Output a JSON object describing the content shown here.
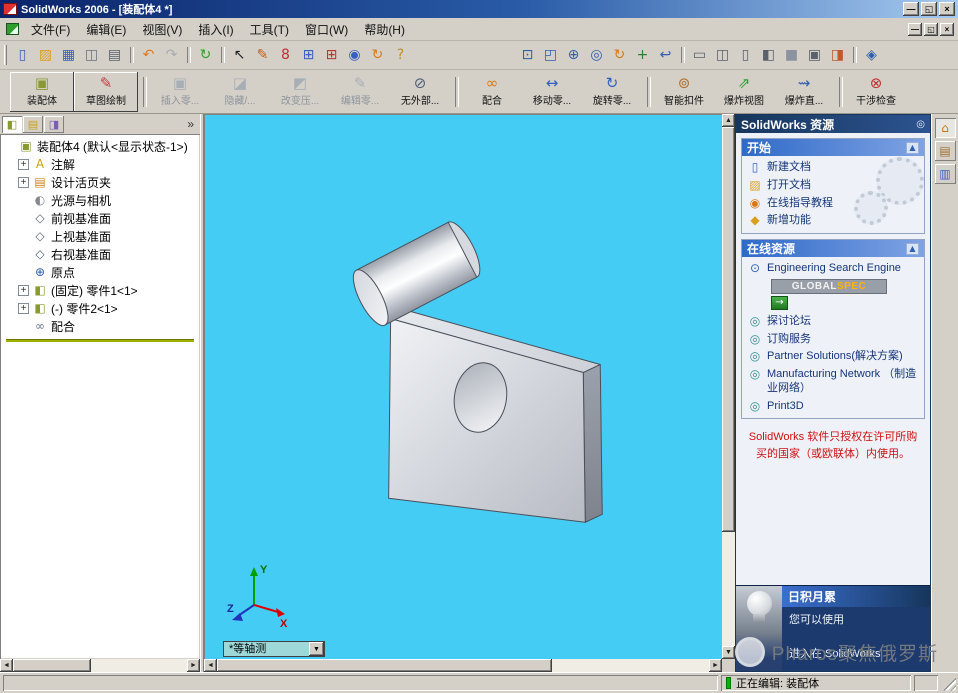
{
  "titlebar": {
    "title": "SolidWorks 2006 - [装配体4 *]"
  },
  "glyphs": {
    "minimize": "—",
    "restore": "◱",
    "close": "×",
    "up": "▲",
    "down": "▼",
    "left": "◄",
    "right": "►",
    "chevron": "»",
    "dropdown": "▼",
    "pin": "◎",
    "go": "→",
    "section_up": "▲",
    "search": "⊙"
  },
  "menubar": {
    "items": [
      "文件(F)",
      "编辑(E)",
      "视图(V)",
      "插入(I)",
      "工具(T)",
      "窗口(W)",
      "帮助(H)"
    ]
  },
  "toolbar_standard": {
    "icons": [
      {
        "name": "new-document-icon",
        "glyph": "▯",
        "color": "#3a5fc0"
      },
      {
        "name": "open-icon",
        "glyph": "▨",
        "color": "#d8a020"
      },
      {
        "name": "save-icon",
        "glyph": "▦",
        "color": "#3a5fc0"
      },
      {
        "name": "make-drawing-icon",
        "glyph": "◫",
        "color": "#6a7282"
      },
      {
        "name": "print-icon",
        "glyph": "▤",
        "color": "#5a616b"
      },
      {
        "name": "undo-icon",
        "glyph": "↶",
        "color": "#e07818",
        "cls": "sep"
      },
      {
        "name": "redo-icon",
        "glyph": "↷",
        "color": "#a6aab2"
      },
      {
        "name": "rebuild-icon",
        "glyph": "↻",
        "color": "#2f9e2f",
        "cls": "sep"
      },
      {
        "name": "select-icon",
        "glyph": "↖",
        "color": "#222222",
        "cls": "sep"
      },
      {
        "name": "sketch-icon",
        "glyph": "✎",
        "color": "#c06020"
      },
      {
        "name": "dimension-icon",
        "glyph": "8",
        "color": "#c03030"
      },
      {
        "name": "grid-icon",
        "glyph": "⊞",
        "color": "#3a5fc0"
      },
      {
        "name": "snap-icon",
        "glyph": "⊞",
        "color": "#c03030"
      },
      {
        "name": "zoom-list-icon",
        "glyph": "◉",
        "color": "#3a5fc0"
      },
      {
        "name": "rotate-icon",
        "glyph": "↻",
        "color": "#e07818"
      },
      {
        "name": "help-icon",
        "glyph": "?",
        "color": "#c09020"
      },
      {
        "name": "zoom-to-fit-icon",
        "glyph": "⊡",
        "color": "#2f5fae",
        "cls": "gap"
      },
      {
        "name": "zoom-area-icon",
        "glyph": "◰",
        "color": "#2f5fae"
      },
      {
        "name": "zoom-in-out-icon",
        "glyph": "⊕",
        "color": "#2f5fae"
      },
      {
        "name": "zoom-selection-icon",
        "glyph": "◎",
        "color": "#2f5fae"
      },
      {
        "name": "rotate-view-icon",
        "glyph": "↻",
        "color": "#d87818"
      },
      {
        "name": "pan-icon",
        "glyph": "+",
        "color": "#2f7f2f"
      },
      {
        "name": "previous-view-icon",
        "glyph": "↩",
        "color": "#2f5fae"
      },
      {
        "name": "wireframe-icon",
        "glyph": "▭",
        "color": "#5a616b",
        "cls": "sep"
      },
      {
        "name": "hidden-lines-visible-icon",
        "glyph": "◫",
        "color": "#5a616b"
      },
      {
        "name": "hidden-lines-removed-icon",
        "glyph": "▯",
        "color": "#5a616b"
      },
      {
        "name": "shaded-edges-icon",
        "glyph": "◧",
        "color": "#5a616b"
      },
      {
        "name": "shaded-icon",
        "glyph": "■",
        "color": "#8b93a0"
      },
      {
        "name": "shadows-icon",
        "glyph": "▣",
        "color": "#5a616b"
      },
      {
        "name": "section-icon",
        "glyph": "◨",
        "color": "#c05a2a"
      },
      {
        "name": "standard-views-icon",
        "glyph": "◈",
        "color": "#2f5fae",
        "cls": "sep"
      }
    ]
  },
  "toolbar_assembly": {
    "buttons": [
      {
        "name": "assembly-toolbar-button",
        "label": "装配体",
        "glyph": "▣",
        "color": "#8a9a30",
        "cls": "framed"
      },
      {
        "name": "sketch-toolbar-button",
        "label": "草图绘制",
        "glyph": "✎",
        "color": "#c04040",
        "cls": "framed"
      },
      {
        "name": "insert-component-button",
        "label": "插入零...",
        "glyph": "▣",
        "color": "#a8aeb6",
        "cls": "disabled sep"
      },
      {
        "name": "hide-show-button",
        "label": "隐藏/...",
        "glyph": "◪",
        "color": "#a8aeb6",
        "cls": "disabled"
      },
      {
        "name": "change-suppression-button",
        "label": "改变压...",
        "glyph": "◩",
        "color": "#a8aeb6",
        "cls": "disabled"
      },
      {
        "name": "edit-part-button",
        "label": "编辑零...",
        "glyph": "✎",
        "color": "#a8aeb6",
        "cls": "disabled"
      },
      {
        "name": "no-external-ref-button",
        "label": "无外部...",
        "glyph": "⊘",
        "color": "#50607a"
      },
      {
        "name": "mate-button",
        "label": "配合",
        "glyph": "∞",
        "color": "#d87818",
        "cls": "sep"
      },
      {
        "name": "move-component-button",
        "label": "移动零...",
        "glyph": "↔",
        "color": "#3060c0"
      },
      {
        "name": "rotate-component-button",
        "label": "旋转零...",
        "glyph": "↻",
        "color": "#3060c0"
      },
      {
        "name": "smart-fasteners-button",
        "label": "智能扣件",
        "glyph": "⊚",
        "color": "#b07030",
        "cls": "sep"
      },
      {
        "name": "exploded-view-button",
        "label": "爆炸视图",
        "glyph": "⇗",
        "color": "#2f9e2f"
      },
      {
        "name": "explode-line-button",
        "label": "爆炸直...",
        "glyph": "⇝",
        "color": "#2f5fae"
      },
      {
        "name": "interference-button",
        "label": "干涉检查",
        "glyph": "⊗",
        "color": "#c03030",
        "cls": "sep"
      }
    ]
  },
  "feature_panel": {
    "chevron": "»",
    "tabs": [
      {
        "name": "featuremanager-tab",
        "glyph": "◧",
        "color": "#8a9a30",
        "cls": "active"
      },
      {
        "name": "propertymanager-tab",
        "glyph": "▤",
        "color": "#caa020"
      },
      {
        "name": "configurationmanager-tab",
        "glyph": "◨",
        "color": "#7a5fb0"
      }
    ]
  },
  "feature_tree": {
    "root": {
      "glyph": "▣",
      "color": "#8a9a30",
      "label": "装配体4 (默认<显示状态-1>)"
    },
    "items": [
      {
        "name": "tree-item-annotations",
        "expand": "+",
        "glyph": "A",
        "color": "#c8a000",
        "label": "注解"
      },
      {
        "name": "tree-item-design-binder",
        "expand": "+",
        "glyph": "▤",
        "color": "#d08020",
        "label": "设计活页夹"
      },
      {
        "name": "tree-item-lights-cameras",
        "expand": "",
        "glyph": "◐",
        "color": "#83898f",
        "label": "光源与相机"
      },
      {
        "name": "tree-item-front-plane",
        "expand": "",
        "glyph": "◇",
        "color": "#5a6570",
        "label": "前视基准面"
      },
      {
        "name": "tree-item-top-plane",
        "expand": "",
        "glyph": "◇",
        "color": "#5a6570",
        "label": "上视基准面"
      },
      {
        "name": "tree-item-right-plane",
        "expand": "",
        "glyph": "◇",
        "color": "#5a6570",
        "label": "右视基准面"
      },
      {
        "name": "tree-item-origin",
        "expand": "",
        "glyph": "⊕",
        "color": "#2f5fae",
        "label": "原点"
      },
      {
        "name": "tree-item-part1",
        "expand": "+",
        "glyph": "◧",
        "color": "#8a9a30",
        "label": "(固定) 零件1<1>"
      },
      {
        "name": "tree-item-part2",
        "expand": "+",
        "glyph": "◧",
        "color": "#8a9a30",
        "label": "(-) 零件2<1>"
      },
      {
        "name": "tree-item-mates",
        "expand": "",
        "glyph": "∞",
        "color": "#6a7590",
        "label": "配合"
      }
    ]
  },
  "viewport": {
    "background": "#45ccf5",
    "view_combo": "*等轴测",
    "triad": {
      "x": "X",
      "y": "Y",
      "z": "Z"
    }
  },
  "task_pane": {
    "title": "SolidWorks 资源",
    "start": {
      "header": "开始",
      "items": [
        {
          "name": "new-document-link",
          "glyph": "▯",
          "color": "#3a5fc0",
          "label": "新建文档"
        },
        {
          "name": "open-document-link",
          "glyph": "▨",
          "color": "#d8a020",
          "label": "打开文档"
        },
        {
          "name": "online-tutorials-link",
          "glyph": "◉",
          "color": "#d87818",
          "label": "在线指导教程"
        },
        {
          "name": "whats-new-link",
          "glyph": "◆",
          "color": "#d8a020",
          "label": "新增功能"
        }
      ]
    },
    "online": {
      "header": "在线资源",
      "search_label": "Engineering Search Engine",
      "logo_part1": "GLOBAL",
      "logo_part2": "SPEC",
      "items": [
        {
          "name": "discussion-forum-link",
          "glyph": "◎",
          "color": "#2f8f8f",
          "label": "探讨论坛"
        },
        {
          "name": "subscription-link",
          "glyph": "◎",
          "color": "#2f8f8f",
          "label": "订购服务"
        },
        {
          "name": "partner-solutions-link",
          "glyph": "◎",
          "color": "#2f8f8f",
          "label": "Partner Solutions(解决方案)"
        },
        {
          "name": "manufacturing-network-link",
          "glyph": "◎",
          "color": "#2f8f8f",
          "label": "Manufacturing Network （制造业网络）"
        },
        {
          "name": "print3d-link",
          "glyph": "◎",
          "color": "#2f8f8f",
          "label": "Print3D"
        }
      ]
    },
    "license_warning": "SolidWorks 软件只授权在许可所购买的国家（或欧联体）内使用。",
    "tip": {
      "header": "日积月累",
      "line1": "您可以使用",
      "line2": "进入在 SolidWorks"
    }
  },
  "side_tabs": {
    "items": [
      {
        "name": "resources-tab",
        "glyph": "⌂",
        "color": "#c07818",
        "cls": "active"
      },
      {
        "name": "design-library-tab",
        "glyph": "▤",
        "color": "#a07030"
      },
      {
        "name": "file-explorer-tab",
        "glyph": "▥",
        "color": "#3a5fc0"
      }
    ]
  },
  "statusbar": {
    "editing": "正在编辑: 装配体"
  },
  "watermark": {
    "text": "Pharos聚焦俄罗斯"
  },
  "colors": {
    "titlebar": "#0a246a",
    "chrome": "#d4d0c8",
    "viewport_background": "#45ccf5",
    "taskpane_header": "#16365c",
    "warning_red": "#cc1111",
    "rollback_green": "#a0b000",
    "status_green": "#00b800"
  }
}
